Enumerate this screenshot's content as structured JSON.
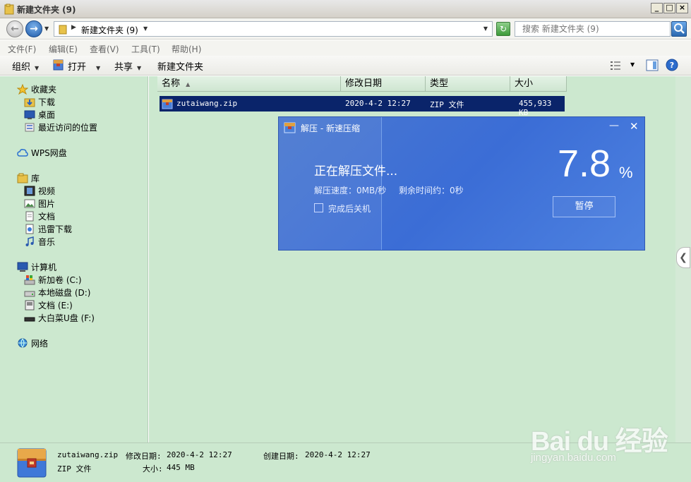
{
  "window": {
    "title": "新建文件夹 (9)",
    "controls": [
      "_",
      "□",
      "×"
    ]
  },
  "address": {
    "crumb": "新建文件夹 (9)",
    "search_placeholder": "搜索 新建文件夹 (9)"
  },
  "menu": [
    "文件(F)",
    "编辑(E)",
    "查看(V)",
    "工具(T)",
    "帮助(H)"
  ],
  "toolbar": {
    "organize": "组织",
    "open": "打开",
    "share": "共享",
    "new_folder": "新建文件夹"
  },
  "sidebar": {
    "favorites": {
      "label": "收藏夹",
      "items": [
        "下载",
        "桌面",
        "最近访问的位置"
      ]
    },
    "wps": "WPS网盘",
    "libraries": {
      "label": "库",
      "items": [
        "视频",
        "图片",
        "文档",
        "迅雷下载",
        "音乐"
      ]
    },
    "computer": {
      "label": "计算机",
      "items": [
        "新加卷 (C:)",
        "本地磁盘 (D:)",
        "文档 (E:)",
        "大白菜U盘 (F:)"
      ]
    },
    "network": "网络"
  },
  "columns": {
    "name": "名称",
    "date": "修改日期",
    "type": "类型",
    "size": "大小"
  },
  "files": [
    {
      "name": "zutaiwang.zip",
      "date": "2020-4-2 12:27",
      "type": "ZIP 文件",
      "size": "455,933 KB"
    }
  ],
  "details": {
    "name": "zutaiwang.zip",
    "modified_label": "修改日期:",
    "modified": "2020-4-2 12:27",
    "created_label": "创建日期:",
    "created": "2020-4-2 12:27",
    "type": "ZIP 文件",
    "size_label": "大小:",
    "size": "445 MB"
  },
  "dialog": {
    "title": "解压 - 新速压缩",
    "status": "正在解压文件...",
    "speed": "解压速度：0MB/秒",
    "remaining": "剩余时间约：0秒",
    "shutdown_label": "完成后关机",
    "shutdown_checked": false,
    "percent": "7.8",
    "percent_sign": "%",
    "pause_label": "暂停",
    "progress_fraction": 0.078
  },
  "watermark": {
    "main": "Bai du 经验",
    "sub": "jingyan.baidu.com"
  }
}
